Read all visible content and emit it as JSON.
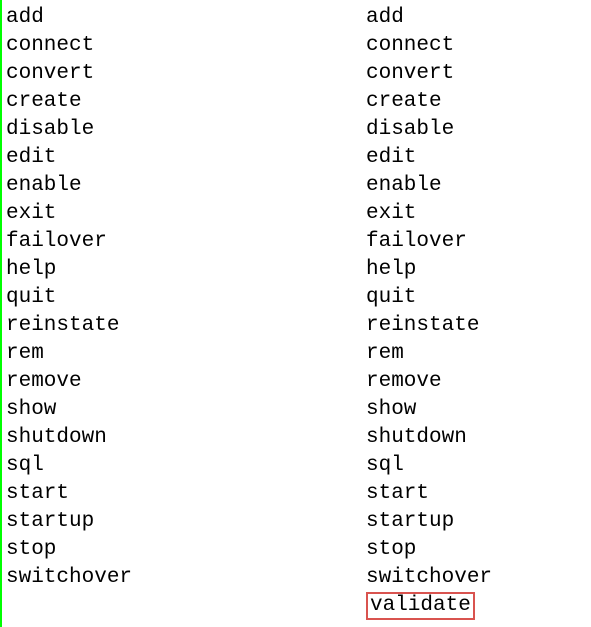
{
  "columns": {
    "left": [
      "add",
      "connect",
      "convert",
      "create",
      "disable",
      "edit",
      "enable",
      "exit",
      "failover",
      "help",
      "quit",
      "reinstate",
      "rem",
      "remove",
      "show",
      "shutdown",
      "sql",
      "start",
      "startup",
      "stop",
      "switchover"
    ],
    "right": [
      "add",
      "connect",
      "convert",
      "create",
      "disable",
      "edit",
      "enable",
      "exit",
      "failover",
      "help",
      "quit",
      "reinstate",
      "rem",
      "remove",
      "show",
      "shutdown",
      "sql",
      "start",
      "startup",
      "stop",
      "switchover",
      "validate"
    ]
  },
  "highlighted_command": "validate"
}
